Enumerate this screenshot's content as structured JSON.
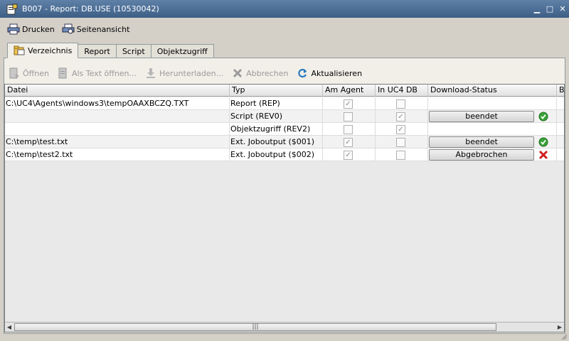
{
  "window": {
    "title": "B007 - Report: DB.USE (10530042)"
  },
  "menubar": {
    "print_label": "Drucken",
    "preview_label": "Seitenansicht"
  },
  "tabs": [
    {
      "label": "Verzeichnis",
      "active": true
    },
    {
      "label": "Report",
      "active": false
    },
    {
      "label": "Script",
      "active": false
    },
    {
      "label": "Objektzugriff",
      "active": false
    }
  ],
  "toolbar": {
    "open_label": "Öffnen",
    "open_text_label": "Als Text öffnen...",
    "download_label": "Herunterladen...",
    "cancel_label": "Abbrechen",
    "refresh_label": "Aktualisieren"
  },
  "table": {
    "columns": [
      "Datei",
      "Typ",
      "Am Agent",
      "In UC4 DB",
      "Download-Status",
      "Be"
    ],
    "rows": [
      {
        "file": "C:\\UC4\\Agents\\windows3\\tempOAAXBCZQ.TXT",
        "type": "Report (REP)",
        "am_agent": true,
        "in_db": false,
        "status": "",
        "status_icon": ""
      },
      {
        "file": "",
        "type": "Script (REV0)",
        "am_agent": false,
        "in_db": true,
        "status": "beendet",
        "status_icon": "success"
      },
      {
        "file": "",
        "type": "Objektzugriff (REV2)",
        "am_agent": false,
        "in_db": true,
        "status": "",
        "status_icon": ""
      },
      {
        "file": "C:\\temp\\test.txt",
        "type": "Ext. Joboutput ($001)",
        "am_agent": true,
        "in_db": false,
        "status": "beendet",
        "status_icon": "success"
      },
      {
        "file": "C:\\temp\\test2.txt",
        "type": "Ext. Joboutput ($002)",
        "am_agent": true,
        "in_db": false,
        "status": "Abgebrochen",
        "status_icon": "error"
      }
    ]
  },
  "colors": {
    "titlebar": "#4a6d96",
    "success": "#3aa33a",
    "error": "#d02020"
  }
}
